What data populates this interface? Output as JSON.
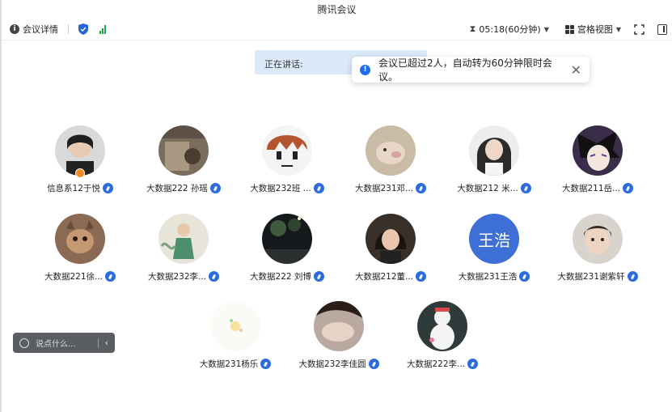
{
  "app": {
    "title": "腾讯会议"
  },
  "toolbar": {
    "meeting_details": "会议详情",
    "timer": "05:18(60分钟)",
    "view_mode": "宫格视图"
  },
  "speaking": {
    "label": "正在讲话:"
  },
  "toast": {
    "message": "会议已超过2人，自动转为60分钟限时会议。"
  },
  "participants": [
    {
      "name": "信息系12于悦"
    },
    {
      "name": "大数据222 孙瑶"
    },
    {
      "name": "大数据232班 ..."
    },
    {
      "name": "大数据231邓..."
    },
    {
      "name": "大数据212 米..."
    },
    {
      "name": "大数据211岳..."
    },
    {
      "name": "大数据221徐..."
    },
    {
      "name": "大数据232李..."
    },
    {
      "name": "大数据222 刘博"
    },
    {
      "name": "大数据212董..."
    },
    {
      "name": "大数据231王浩",
      "avatar_text": "王浩"
    },
    {
      "name": "大数据231谢紫轩"
    },
    {
      "name": "大数据231杨乐"
    },
    {
      "name": "大数据232李佳圆"
    },
    {
      "name": "大数据222李..."
    }
  ],
  "chat": {
    "placeholder": "说点什么..."
  },
  "colors": {
    "accent": "#1e6cf0",
    "speaking_bg": "#dce9f8",
    "signal": "#19a54a"
  }
}
